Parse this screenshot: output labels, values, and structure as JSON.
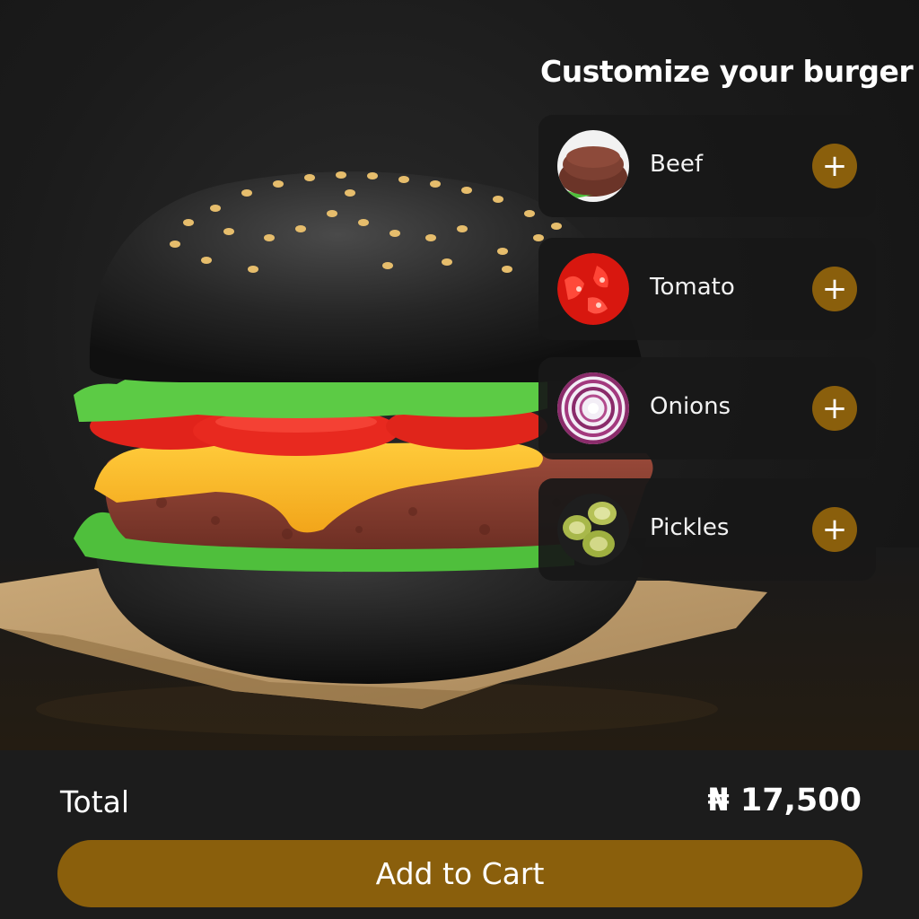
{
  "customize": {
    "title": "Customize your burger",
    "ingredients": [
      {
        "name": "Beef",
        "add_icon": "plus-icon"
      },
      {
        "name": "Tomato",
        "add_icon": "plus-icon"
      },
      {
        "name": "Onions",
        "add_icon": "plus-icon"
      },
      {
        "name": "Pickles",
        "add_icon": "plus-icon"
      }
    ]
  },
  "footer": {
    "total_label": "Total",
    "total_price": "₦ 17,500",
    "add_to_cart_label": "Add to Cart"
  },
  "icons": {
    "add": "+"
  },
  "colors": {
    "accent": "#8a5f0c",
    "background": "#141414",
    "card": "#181818",
    "panel": "#1c1c1c"
  }
}
